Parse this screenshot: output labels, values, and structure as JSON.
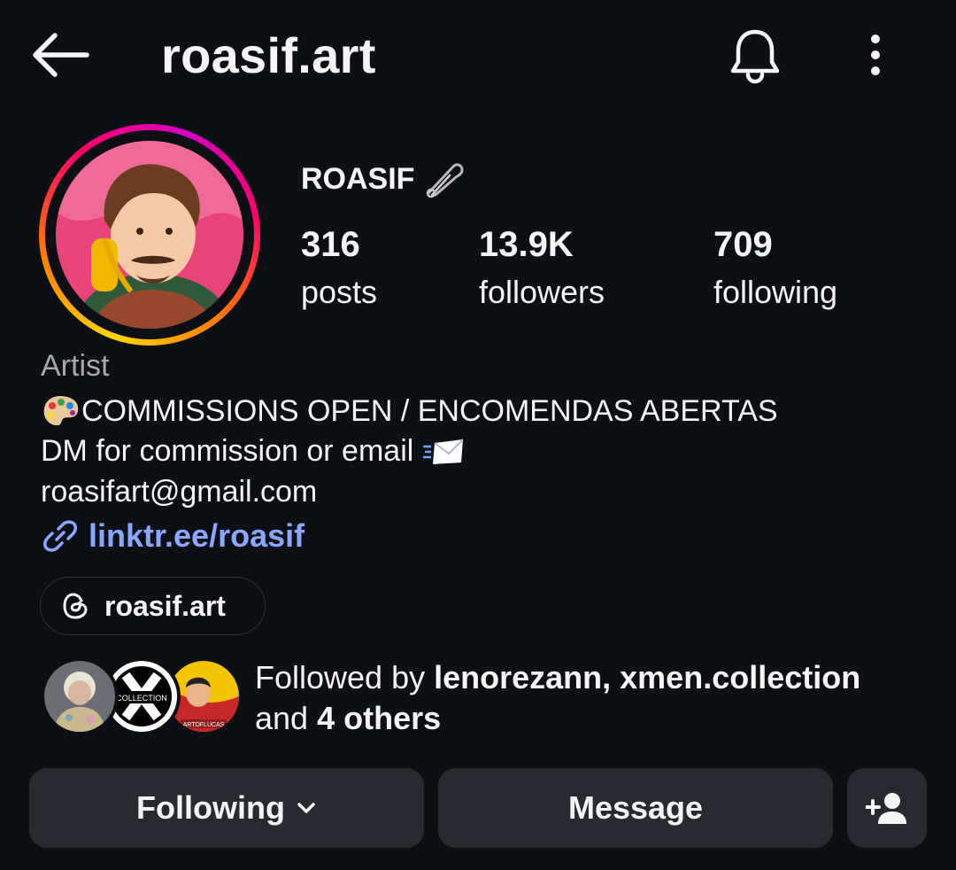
{
  "header": {
    "username": "roasif.art"
  },
  "profile": {
    "display_name": "ROASIF",
    "stats": {
      "posts": {
        "value": "316",
        "label": "posts"
      },
      "followers": {
        "value": "13.9K",
        "label": "followers"
      },
      "following": {
        "value": "709",
        "label": "following"
      }
    },
    "category": "Artist",
    "bio_lines": [
      "COMMISSIONS OPEN / ENCOMENDAS ABERTAS",
      "DM for commission or email",
      "roasifart@gmail.com"
    ],
    "link": "linktr.ee/roasif",
    "threads_handle": "roasif.art"
  },
  "followed_by": {
    "prefix": "Followed by",
    "names": "lenorezann, xmen.collection",
    "and": "and",
    "others": "4 others",
    "avatar_labels": [
      "COLLECTION",
      "ARTOFLUCAS"
    ]
  },
  "actions": {
    "following": "Following",
    "message": "Message"
  },
  "icons": [
    "back-arrow-icon",
    "bell-icon",
    "more-vertical-icon",
    "safety-pin-icon",
    "palette-icon",
    "envelope-icon",
    "link-icon",
    "threads-icon",
    "chevron-down-icon",
    "add-user-icon"
  ],
  "colors": {
    "background": "#0c0f14",
    "button": "#262b32",
    "link": "#8aa8ff",
    "muted": "#a8a8a8"
  }
}
